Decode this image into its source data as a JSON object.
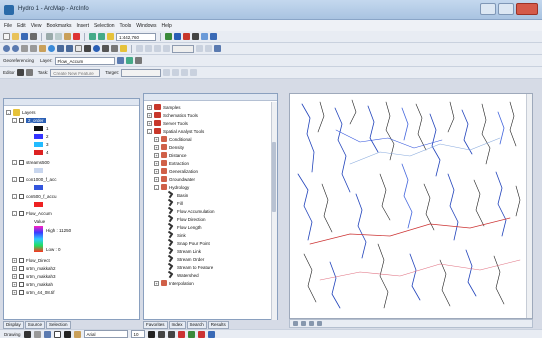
{
  "window": {
    "title": "Hydro 1 - ArcMap - ArcInfo"
  },
  "menu": [
    "File",
    "Edit",
    "View",
    "Bookmarks",
    "Insert",
    "Selection",
    "Tools",
    "Windows",
    "Help"
  ],
  "standard_toolbar": {
    "scale": "1:442,760"
  },
  "georef_toolbar": {
    "label": "Georeferencing",
    "layer_label": "Layer:",
    "layer_value": "Flow_Accum"
  },
  "editor_toolbar": {
    "label": "Editor",
    "task_label": "Task:",
    "task_value": "Create New Feature",
    "target_label": "Target:"
  },
  "toc": {
    "root": "Layers",
    "items": [
      {
        "name": "2_order",
        "selected": true,
        "swatches": [
          "#111111",
          "#3333ff",
          "#22bbff",
          "#dd2222"
        ],
        "labels": [
          "1",
          "2",
          "3",
          "4"
        ]
      },
      {
        "name": "streams500",
        "swatch_color": "#c8d6ee"
      },
      {
        "name": "con1000_f_acc",
        "swatch_color": "#3355dd"
      },
      {
        "name": "con500_f_accu",
        "swatch_color": "#ee2222"
      },
      {
        "name": "Flow_Accum",
        "value_label": "Value",
        "high_label": "High : 11250",
        "low_label": "Low : 0"
      },
      {
        "name": "Flow_Direct"
      },
      {
        "name": "srtm_makkah2"
      },
      {
        "name": "srtm_makkah3"
      },
      {
        "name": "srtm_makkah"
      },
      {
        "name": "srtm_44_08.tif"
      }
    ],
    "tabs": [
      "Display",
      "Source",
      "Selection"
    ]
  },
  "toolbox": {
    "top": [
      "Samples",
      "Schematics Tools",
      "Server Tools",
      "Spatial Analyst Tools"
    ],
    "spatial_children": [
      "Conditional",
      "Density",
      "Distance",
      "Extraction",
      "Generalization",
      "Groundwater",
      "Hydrology"
    ],
    "hydrology_tools": [
      "Basin",
      "Fill",
      "Flow Accumulation",
      "Flow Direction",
      "Flow Length",
      "Sink",
      "Snap Pour Point",
      "Stream Link",
      "Stream Order",
      "Stream to Feature",
      "Watershed"
    ],
    "after": [
      "Interpolation"
    ],
    "tabs": [
      "Favorites",
      "Index",
      "Search",
      "Results"
    ]
  },
  "drawing_toolbar": {
    "label": "Drawing",
    "font": "Arial",
    "size": "10"
  },
  "colors": {
    "selection": "#2a5fb5",
    "stream_blue": "#2244bb",
    "stream_red": "#cc3333"
  }
}
